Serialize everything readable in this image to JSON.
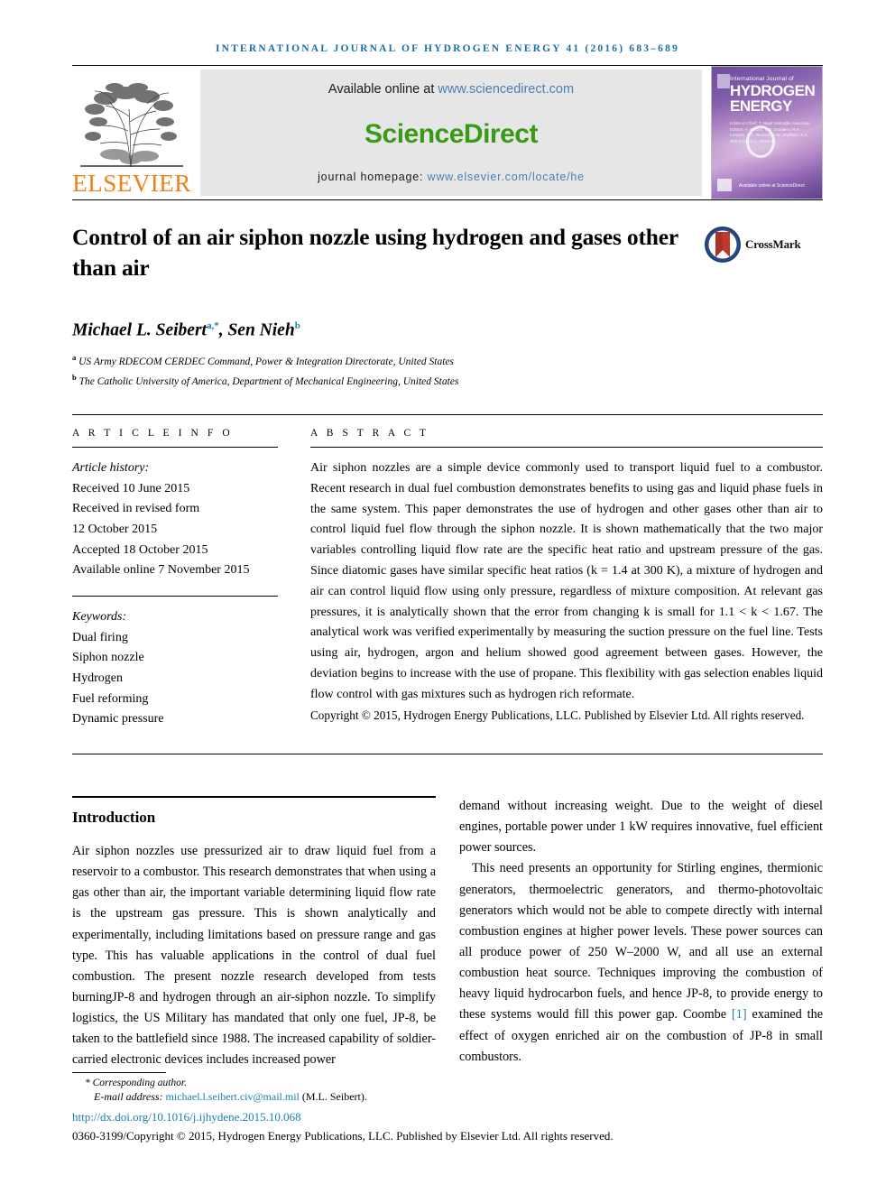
{
  "running_head": "international journal of hydrogen energy 41 (2016) 683–689",
  "masthead": {
    "elsevier_wordmark": "ELSEVIER",
    "available_prefix": "Available online at ",
    "available_url": "www.sciencedirect.com",
    "sciencedirect_logo": "ScienceDirect",
    "homepage_prefix": "journal homepage: ",
    "homepage_url": "www.elsevier.com/locate/he",
    "cover": {
      "top_label": "International Journal of",
      "title_line1": "HYDROGEN",
      "title_line2": "ENERGY",
      "editors": "Editor-in-Chief: T. Nejat Veziroğlu   Associate Editors: A. Bolotin, D.S. Dondero, R.A. Lemons, A.C. Resnick, J.W. Sheffield, S.A. Sherif and D.A. Ventrudo",
      "sciencedirect_mark": "Available online at ScienceDirect"
    }
  },
  "article": {
    "title": "Control of an air siphon nozzle using hydrogen and gases other than air",
    "crossmark_label": "CrossMark",
    "authors": [
      {
        "name": "Michael L. Seibert",
        "marks": "a,*"
      },
      {
        "name": "Sen Nieh",
        "marks": "b"
      }
    ],
    "authors_separator": ", ",
    "affiliations": [
      {
        "mark": "a",
        "text": "US Army RDECOM CERDEC Command, Power & Integration Directorate, United States"
      },
      {
        "mark": "b",
        "text": "The Catholic University of America, Department of Mechanical Engineering, United States"
      }
    ]
  },
  "article_info": {
    "label": "A R T I C L E  I N F O",
    "history_heading": "Article history:",
    "history": [
      "Received 10 June 2015",
      "Received in revised form",
      "12 October 2015",
      "Accepted 18 October 2015",
      "Available online 7 November 2015"
    ],
    "keywords_heading": "Keywords:",
    "keywords": [
      "Dual firing",
      "Siphon nozzle",
      "Hydrogen",
      "Fuel reforming",
      "Dynamic pressure"
    ]
  },
  "abstract": {
    "label": "A B S T R A C T",
    "text": "Air siphon nozzles are a simple device commonly used to transport liquid fuel to a combustor. Recent research in dual fuel combustion demonstrates benefits to using gas and liquid phase fuels in the same system. This paper demonstrates the use of hydrogen and other gases other than air to control liquid fuel flow through the siphon nozzle. It is shown mathematically that the two major variables controlling liquid flow rate are the specific heat ratio and upstream pressure of the gas. Since diatomic gases have similar specific heat ratios (k = 1.4 at 300 K), a mixture of hydrogen and air can control liquid flow using only pressure, regardless of mixture composition. At relevant gas pressures, it is analytically shown that the error from changing k is small for 1.1 < k < 1.67. The analytical work was verified experimentally by measuring the suction pressure on the fuel line. Tests using air, hydrogen, argon and helium showed good agreement between gases. However, the deviation begins to increase with the use of propane. This flexibility with gas selection enables liquid flow control with gas mixtures such as hydrogen rich reformate.",
    "copyright": "Copyright © 2015, Hydrogen Energy Publications, LLC. Published by Elsevier Ltd. All rights reserved."
  },
  "body": {
    "section_heading": "Introduction",
    "left_paragraphs": [
      "Air siphon nozzles use pressurized air to draw liquid fuel from a reservoir to a combustor. This research demonstrates that when using a gas other than air, the important variable determining liquid flow rate is the upstream gas pressure. This is shown analytically and experimentally, including limitations based on pressure range and gas type. This has valuable applications in the control of dual fuel combustion. The present nozzle research developed from tests burningJP-8 and hydrogen through an air-siphon nozzle. To simplify logistics, the US Military has mandated that only one fuel, JP-8, be taken to the battlefield since 1988. The increased capability of soldier-carried electronic devices includes increased power"
    ],
    "right_paragraph_1": "demand without increasing weight. Due to the weight of diesel engines, portable power under 1 kW requires innovative, fuel efficient power sources.",
    "right_paragraph_2_a": "This need presents an opportunity for Stirling engines, thermionic generators, thermoelectric generators, and thermo-photovoltaic generators which would not be able to compete directly with internal combustion engines at higher power levels. These power sources can all produce power of 250 W–2000 W, and all use an external combustion heat source. Techniques improving the combustion of heavy liquid hydrocarbon fuels, and hence JP-8, to provide energy to these systems would fill this power gap. Coombe ",
    "right_citation": "[1]",
    "right_paragraph_2_b": " examined the effect of oxygen enriched air on the combustion of JP-8 in small combustors."
  },
  "footer": {
    "corresponding_author": "* Corresponding author.",
    "email_label": "E-mail address: ",
    "email": "michael.l.seibert.civ@mail.mil",
    "email_suffix": " (M.L. Seibert).",
    "doi": "http://dx.doi.org/10.1016/j.ijhydene.2015.10.068",
    "issn_line": "0360-3199/Copyright © 2015, Hydrogen Energy Publications, LLC. Published by Elsevier Ltd. All rights reserved."
  },
  "colors": {
    "journal_blue": "#1a6fa8",
    "elsevier_orange": "#f07f1a",
    "sciencedirect_green": "#3a9a18",
    "link_blue": "#1a7fa8"
  }
}
